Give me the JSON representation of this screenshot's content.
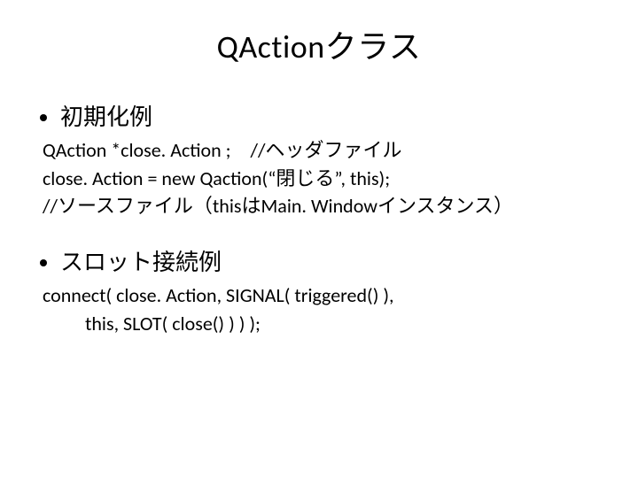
{
  "title": "QActionクラス",
  "section1": {
    "heading": "初期化例",
    "line1": "QAction *close. Action ; //ヘッダファイル",
    "line2": "close. Action = new Qaction(“閉じる”, this);",
    "line3": "//ソースファイル（thisはMain. Windowインスタンス）"
  },
  "section2": {
    "heading": "スロット接続例",
    "line1": "connect( close. Action, SIGNAL( triggered() ),",
    "line2": "this, SLOT( close() ) ) );"
  }
}
